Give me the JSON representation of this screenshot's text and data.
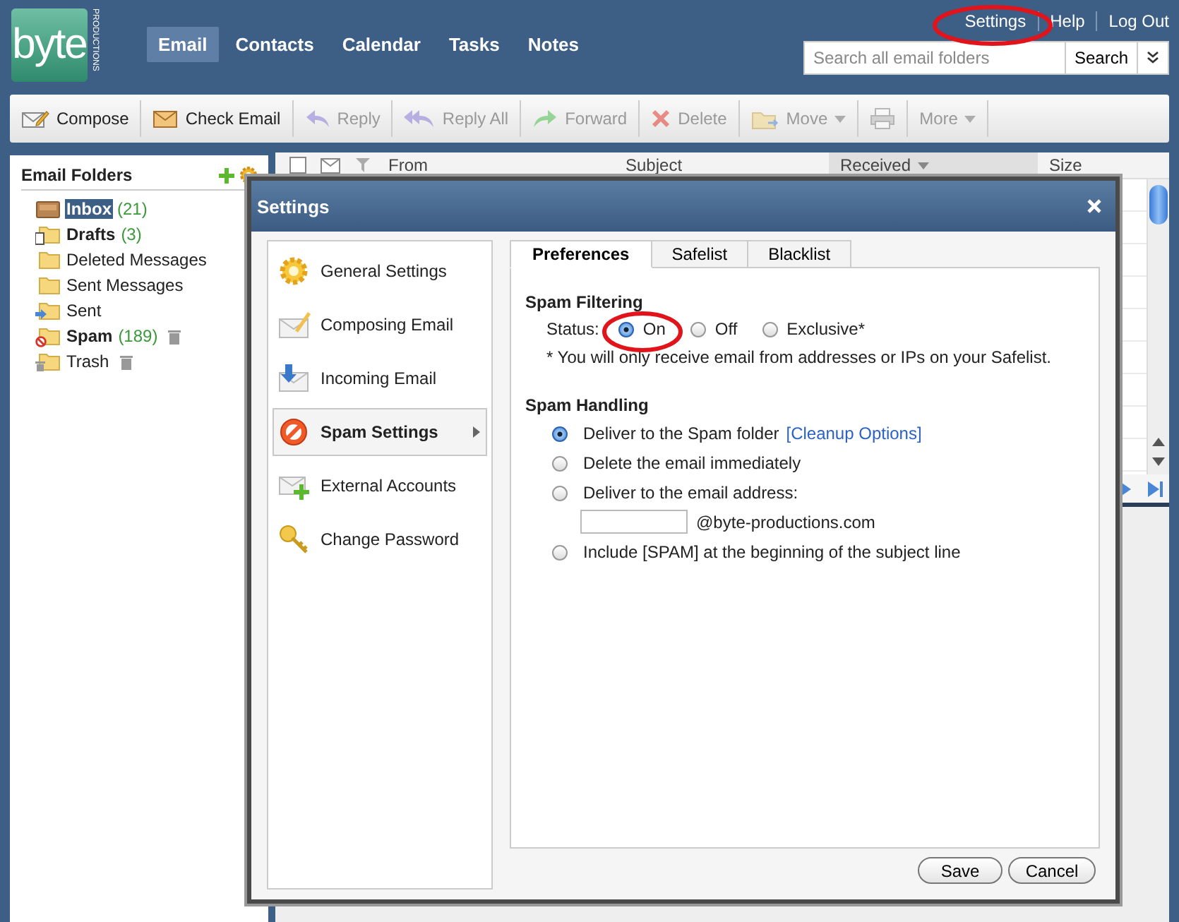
{
  "logo": {
    "text": "byte",
    "subtext": "PRODUCTIONS"
  },
  "nav": [
    {
      "label": "Email",
      "selected": true
    },
    {
      "label": "Contacts",
      "selected": false
    },
    {
      "label": "Calendar",
      "selected": false
    },
    {
      "label": "Tasks",
      "selected": false
    },
    {
      "label": "Notes",
      "selected": false
    }
  ],
  "top_links": [
    "Settings",
    "Help",
    "Log Out"
  ],
  "search": {
    "placeholder": "Search all email folders",
    "button": "Search"
  },
  "toolbar": [
    {
      "kind": "compose",
      "label": "Compose",
      "disabled": false,
      "dropdown": false
    },
    {
      "kind": "check",
      "label": "Check Email",
      "disabled": false,
      "dropdown": false
    },
    {
      "kind": "reply",
      "label": "Reply",
      "disabled": true,
      "dropdown": false
    },
    {
      "kind": "replyall",
      "label": "Reply All",
      "disabled": true,
      "dropdown": false
    },
    {
      "kind": "forward",
      "label": "Forward",
      "disabled": true,
      "dropdown": false
    },
    {
      "kind": "delete",
      "label": "Delete",
      "disabled": true,
      "dropdown": false
    },
    {
      "kind": "move",
      "label": "Move",
      "disabled": true,
      "dropdown": true
    },
    {
      "kind": "print",
      "disabled": true,
      "dropdown": false
    },
    {
      "kind": "more",
      "label": "More",
      "disabled": true,
      "dropdown": true
    }
  ],
  "folders": {
    "title": "Email Folders",
    "items": [
      {
        "kind": "inbox",
        "name": "Inbox",
        "count": "(21)",
        "unread": true,
        "selected": true,
        "empty_button": false
      },
      {
        "kind": "drafts",
        "name": "Drafts",
        "count": "(3)",
        "unread": true,
        "selected": false,
        "empty_button": false
      },
      {
        "kind": "folder",
        "name": "Deleted Messages",
        "unread": false,
        "selected": false,
        "empty_button": false
      },
      {
        "kind": "folder",
        "name": "Sent Messages",
        "unread": false,
        "selected": false,
        "empty_button": false
      },
      {
        "kind": "sent",
        "name": "Sent",
        "unread": false,
        "selected": false,
        "empty_button": false
      },
      {
        "kind": "spam",
        "name": "Spam",
        "count": "(189)",
        "unread": true,
        "selected": false,
        "empty_button": true
      },
      {
        "kind": "trash",
        "name": "Trash",
        "unread": false,
        "selected": false,
        "empty_button": true
      }
    ]
  },
  "message_list": {
    "columns": [
      {
        "label": "From",
        "sorted": false
      },
      {
        "label": "Subject",
        "sorted": false
      },
      {
        "label": "Received",
        "sorted": true
      },
      {
        "label": "Size",
        "sorted": false
      }
    ]
  },
  "dialog": {
    "title": "Settings",
    "nav": [
      {
        "kind": "general",
        "label": "General Settings",
        "selected": false
      },
      {
        "kind": "composing",
        "label": "Composing Email",
        "selected": false
      },
      {
        "kind": "incoming",
        "label": "Incoming Email",
        "selected": false
      },
      {
        "kind": "spam",
        "label": "Spam Settings",
        "selected": true
      },
      {
        "kind": "external",
        "label": "External Accounts",
        "selected": false
      },
      {
        "kind": "password",
        "label": "Change Password",
        "selected": false
      }
    ],
    "tabs": [
      {
        "label": "Preferences",
        "selected": true
      },
      {
        "label": "Safelist",
        "selected": false
      },
      {
        "label": "Blacklist",
        "selected": false
      }
    ],
    "spam_filtering": {
      "heading": "Spam Filtering",
      "status_label": "Status:",
      "options": [
        {
          "label": "On",
          "selected": true
        },
        {
          "label": "Off",
          "selected": false
        },
        {
          "label": "Exclusive*",
          "selected": false
        }
      ],
      "note": "* You will only receive email from addresses or IPs on your Safelist."
    },
    "spam_handling": {
      "heading": "Spam Handling",
      "options": [
        {
          "label": "Deliver to the Spam folder",
          "link": "[Cleanup Options]",
          "selected": true
        },
        {
          "label": "Delete the email immediately",
          "selected": false
        },
        {
          "label": "Deliver to the email address:",
          "field_suffix": "@byte-productions.com",
          "selected": false
        },
        {
          "label": "Include [SPAM] at the beginning of the subject line",
          "selected": false
        }
      ]
    },
    "buttons": [
      "Save",
      "Cancel"
    ]
  }
}
